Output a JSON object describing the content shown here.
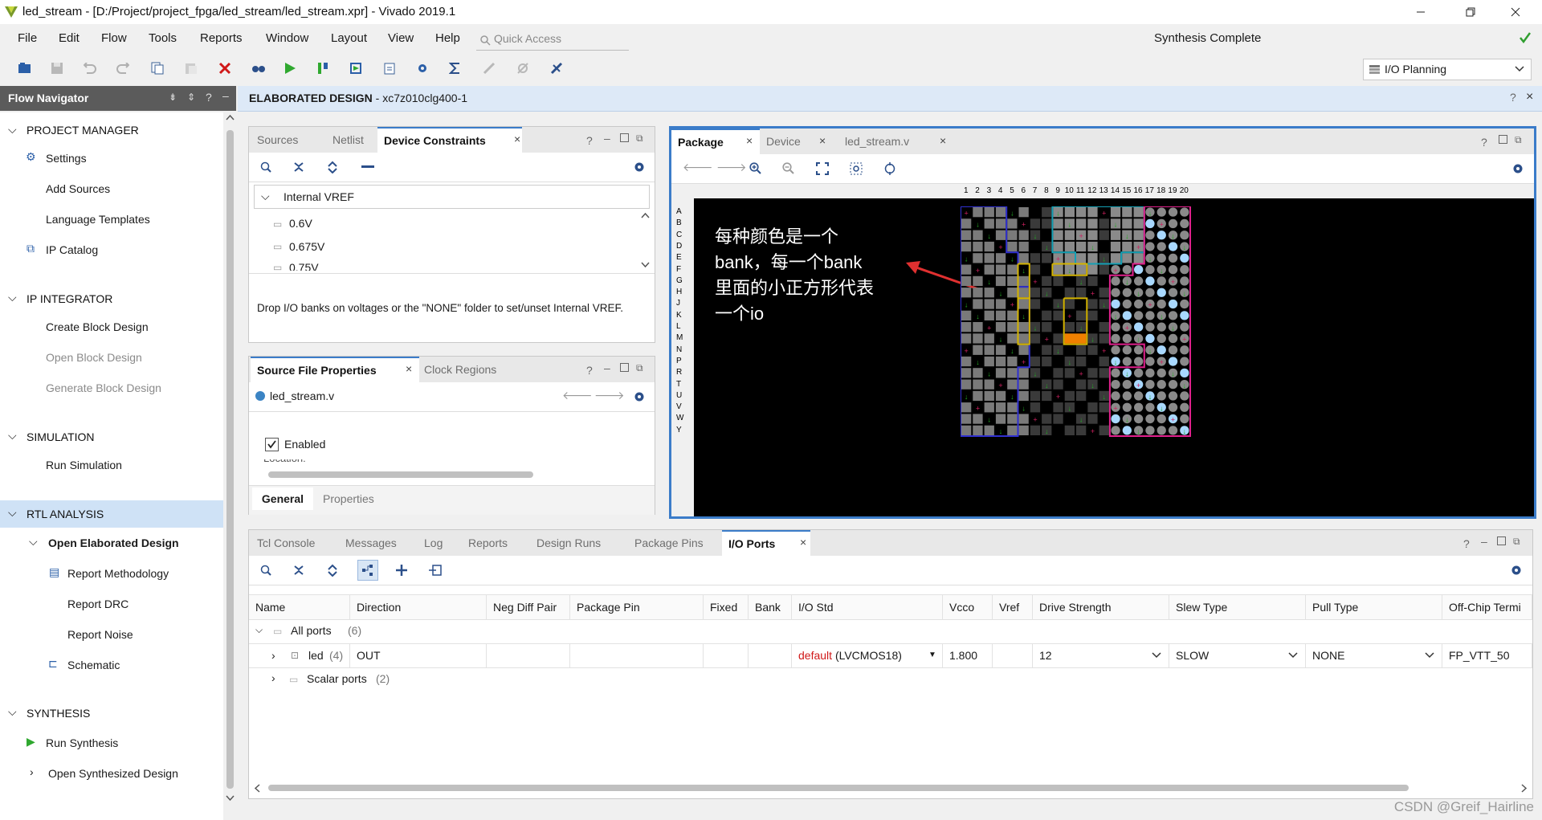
{
  "window": {
    "title": "led_stream - [D:/Project/project_fpga/led_stream/led_stream.xpr] - Vivado 2019.1"
  },
  "menu": [
    "File",
    "Edit",
    "Flow",
    "Tools",
    "Reports",
    "Window",
    "Layout",
    "View",
    "Help"
  ],
  "quick_access": {
    "placeholder": "Quick Access"
  },
  "status": {
    "text": "Synthesis Complete"
  },
  "layout_select": {
    "value": "I/O Planning"
  },
  "flow_navigator": {
    "title": "Flow Navigator",
    "sections": [
      {
        "label": "PROJECT MANAGER",
        "items": [
          "Settings",
          "Add Sources",
          "Language Templates",
          "IP Catalog"
        ]
      },
      {
        "label": "IP INTEGRATOR",
        "items": [
          "Create Block Design",
          "Open Block Design",
          "Generate Block Design"
        ]
      },
      {
        "label": "SIMULATION",
        "items": [
          "Run Simulation"
        ]
      },
      {
        "label": "RTL ANALYSIS",
        "items": [
          "Open Elaborated Design",
          "Report Methodology",
          "Report DRC",
          "Report Noise",
          "Schematic"
        ]
      },
      {
        "label": "SYNTHESIS",
        "items": [
          "Run Synthesis",
          "Open Synthesized Design"
        ]
      }
    ]
  },
  "elaborated": {
    "label": "ELABORATED DESIGN",
    "part": " - xc7z010clg400-1"
  },
  "constraints_panel": {
    "tabs": [
      "Sources",
      "Netlist",
      "Device Constraints"
    ],
    "tree_root": "Internal VREF",
    "tree_items": [
      "0.6V",
      "0.675V",
      "0.75V"
    ],
    "hint": "Drop I/O banks on voltages or the \"NONE\" folder to set/unset Internal VREF."
  },
  "props_panel": {
    "tabs": [
      "Source File Properties",
      "Clock Regions"
    ],
    "file": "led_stream.v",
    "enabled_label": "Enabled",
    "bottom_tabs": [
      "General",
      "Properties"
    ]
  },
  "package_panel": {
    "tabs": [
      "Package",
      "Device",
      "led_stream.v"
    ],
    "col_labels": [
      "1",
      "2",
      "3",
      "4",
      "5",
      "6",
      "7",
      "8",
      "9",
      "10",
      "11",
      "12",
      "13",
      "14",
      "15",
      "16",
      "17",
      "18",
      "19",
      "20"
    ],
    "row_labels": [
      "A",
      "B",
      "C",
      "D",
      "E",
      "F",
      "G",
      "H",
      "J",
      "K",
      "L",
      "M",
      "N",
      "P",
      "R",
      "T",
      "U",
      "V",
      "W",
      "Y"
    ],
    "annotation_lines": [
      "每种颜色是一个",
      "bank，每一个bank",
      "里面的小正方形代表",
      "一个io"
    ]
  },
  "console_panel": {
    "tabs": [
      "Tcl Console",
      "Messages",
      "Log",
      "Reports",
      "Design Runs",
      "Package Pins",
      "I/O Ports"
    ],
    "columns": [
      "Name",
      "Direction",
      "Neg Diff Pair",
      "Package Pin",
      "Fixed",
      "Bank",
      "I/O Std",
      "Vcco",
      "Vref",
      "Drive Strength",
      "Slew Type",
      "Pull Type",
      "Off-Chip Termi"
    ],
    "rows": {
      "all_ports": {
        "name": "All ports",
        "count": "(6)"
      },
      "led": {
        "name": "led",
        "count": "(4)",
        "direction": "OUT",
        "iostd_default": "default",
        "iostd_value": "(LVCMOS18)",
        "vcco": "1.800",
        "drive": "12",
        "slew": "SLOW",
        "pull": "NONE",
        "term": "FP_VTT_50"
      },
      "scalar": {
        "name": "Scalar ports",
        "count": "(2)"
      }
    }
  },
  "watermark": "CSDN @Greif_Hairline",
  "colors": {
    "accent": "#3b7cc9",
    "bank_blue": "#3030d0",
    "bank_teal": "#14a0b4",
    "bank_pink": "#e0208c",
    "bank_yellow": "#d4b400",
    "orange": "#f08000",
    "annotation_arrow": "#e03030"
  }
}
